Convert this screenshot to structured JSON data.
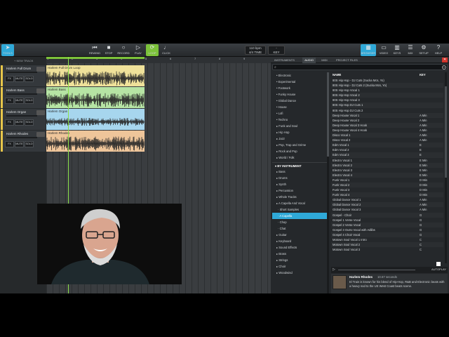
{
  "toolbar": {
    "tools_label": "TOOLS",
    "rewind_label": "REWIND",
    "stop_label": "STOP",
    "record_label": "RECORD",
    "play_label": "PLAY",
    "loop_label": "LOOP",
    "click_label": "CLICK",
    "tempo_value": "110 bpm",
    "time_sig": "4/4 TIME",
    "key_value": "-",
    "key_label": "KEY",
    "browser_label": "BROWSER",
    "video_label": "VIDEO",
    "keys_label": "KEYS",
    "mix_label": "MIX",
    "setup_label": "SETUP",
    "help_label": "HELP"
  },
  "tracks": {
    "new_track_label": "+ NEW TRACK",
    "items": [
      {
        "name": "Harlem Full Drum",
        "fx": "FX",
        "mute": "MUTE",
        "solo": "SOLO"
      },
      {
        "name": "Harlem Bass",
        "fx": "FX",
        "mute": "MUTE",
        "solo": "SOLO"
      },
      {
        "name": "Harlem Organ",
        "fx": "FX",
        "mute": "MUTE",
        "solo": "SOLO"
      },
      {
        "name": "Harlem Rhodes",
        "fx": "FX",
        "mute": "MUTE",
        "solo": "SOLO"
      }
    ]
  },
  "arrange": {
    "ruler": [
      "1",
      "2",
      "3",
      "4",
      "5",
      "6",
      "7",
      "8",
      "9"
    ],
    "clips": [
      {
        "name": "Harlem Full Drum Loop",
        "color": "#efe19a"
      },
      {
        "name": "Harlem Bass",
        "color": "#b6e4a4"
      },
      {
        "name": "Harlem Organ",
        "color": "#a7d6ee"
      },
      {
        "name": "Harlem Rhodes",
        "color": "#eec59a"
      }
    ]
  },
  "browser": {
    "tabs": [
      "INSTRUMENTS",
      "AUDIO",
      "MIDI",
      "PROJECT FILES"
    ],
    "active_tab": "AUDIO",
    "search_placeholder": "",
    "categories": [
      {
        "label": "Electronic",
        "type": "item"
      },
      {
        "label": "Experimental",
        "type": "item"
      },
      {
        "label": "Footwork",
        "type": "item"
      },
      {
        "label": "Funky House",
        "type": "item"
      },
      {
        "label": "Global Dance",
        "type": "item"
      },
      {
        "label": "House",
        "type": "item"
      },
      {
        "label": "Lofi",
        "type": "item"
      },
      {
        "label": "Techno",
        "type": "item"
      },
      {
        "label": "Funk and Soul",
        "type": "item2"
      },
      {
        "label": "Hip Hop",
        "type": "item2"
      },
      {
        "label": "Jazz",
        "type": "item2"
      },
      {
        "label": "Pop, Trap and Grime",
        "type": "item2"
      },
      {
        "label": "Rock and Pop",
        "type": "item2"
      },
      {
        "label": "World / Folk",
        "type": "item2"
      },
      {
        "label": "BY INSTRUMENT",
        "type": "hdr"
      },
      {
        "label": "Bass",
        "type": "item2"
      },
      {
        "label": "Drums",
        "type": "item2"
      },
      {
        "label": "Synth",
        "type": "item2"
      },
      {
        "label": "Percussion",
        "type": "item2"
      },
      {
        "label": "Whole Tracks",
        "type": "item2"
      },
      {
        "label": "A Capella And Vocal",
        "type": "item2"
      },
      {
        "label": "Short Samples",
        "type": "sub"
      },
      {
        "label": "A Capella",
        "type": "sel"
      },
      {
        "label": "Chop",
        "type": "sub"
      },
      {
        "label": "Chat",
        "type": "sub"
      },
      {
        "label": "Guitar",
        "type": "item2"
      },
      {
        "label": "Keyboard",
        "type": "item2"
      },
      {
        "label": "Sound Effects",
        "type": "item2"
      },
      {
        "label": "Brass",
        "type": "item2"
      },
      {
        "label": "Strings",
        "type": "item2"
      },
      {
        "label": "Choir",
        "type": "item2"
      },
      {
        "label": "Woodwind",
        "type": "item2"
      }
    ],
    "list_headers": {
      "name": "NAME",
      "key": "KEY"
    },
    "rows": [
      {
        "name": "80S Hip Hop - DJ Cuts (Sucka Mcs, Yo)",
        "key": ""
      },
      {
        "name": "80S Hip Hop - DJ Cuts 2 (Sucka Mcs, Yo)",
        "key": ""
      },
      {
        "name": "80S Hip Hop Vocal 1",
        "key": ""
      },
      {
        "name": "80S Hip Hop Vocal 2",
        "key": ""
      },
      {
        "name": "80S Hip Hop Vocal 3",
        "key": ""
      },
      {
        "name": "80S Hip Hop DJ Cuts 1",
        "key": ""
      },
      {
        "name": "80S Hip Hop DJ Cuts 2",
        "key": ""
      },
      {
        "name": "Deep House Vocal 1",
        "key": "A Min"
      },
      {
        "name": "Deep House Vocal 2",
        "key": "A Min"
      },
      {
        "name": "Deep House Vocal 3 Hook",
        "key": "A Min"
      },
      {
        "name": "Deep House Vocal 4 Hook",
        "key": "A Min"
      },
      {
        "name": "Disco Vocal 1",
        "key": "A Min"
      },
      {
        "name": "Disco Vocal 2",
        "key": "A Min"
      },
      {
        "name": "Edm Vocal 1",
        "key": "E"
      },
      {
        "name": "Edm Vocal 2",
        "key": "E"
      },
      {
        "name": "Edm Vocal 3",
        "key": "E"
      },
      {
        "name": "Electro Vocal 1",
        "key": "E Min"
      },
      {
        "name": "Electro Vocal 2",
        "key": "E Min"
      },
      {
        "name": "Electro Vocal 3",
        "key": "E Min"
      },
      {
        "name": "Electro Vocal 4",
        "key": "E Min"
      },
      {
        "name": "Funk Vocal 1",
        "key": "D Min"
      },
      {
        "name": "Funk Vocal 2",
        "key": "D Min"
      },
      {
        "name": "Funk Vocal 3",
        "key": "D Min"
      },
      {
        "name": "Funk Vocal 4",
        "key": "D Min"
      },
      {
        "name": "Global Dance Vocal 1",
        "key": "A Min"
      },
      {
        "name": "Global Dance Vocal 2",
        "key": "A Min"
      },
      {
        "name": "Global Dance Vocal 3",
        "key": "A Min"
      },
      {
        "name": "Gospel - Choir",
        "key": "G"
      },
      {
        "name": "Gospel 1 Verse Vocal",
        "key": "G"
      },
      {
        "name": "Gospel 2 Verse Vocal",
        "key": "G"
      },
      {
        "name": "Gospel 3 Outro Vocal with Adlibs",
        "key": "G"
      },
      {
        "name": "Gospel 4 Choir Vocal",
        "key": "G"
      },
      {
        "name": "Motown Soul Vocal 1 Intro",
        "key": "C"
      },
      {
        "name": "Motown Soul Vocal 2",
        "key": "C"
      },
      {
        "name": "Motown Soul Vocal 3",
        "key": "C"
      }
    ],
    "player": {
      "autoplay_label": "AUTOPLAY"
    },
    "info": {
      "title": "Harlem Rhodes",
      "duration": "10.67 seconds",
      "description": "El Train is known for his blend of Hip-Hop, R&B and Electronic beats with a heavy nod to the US West Coast beats scene."
    }
  }
}
